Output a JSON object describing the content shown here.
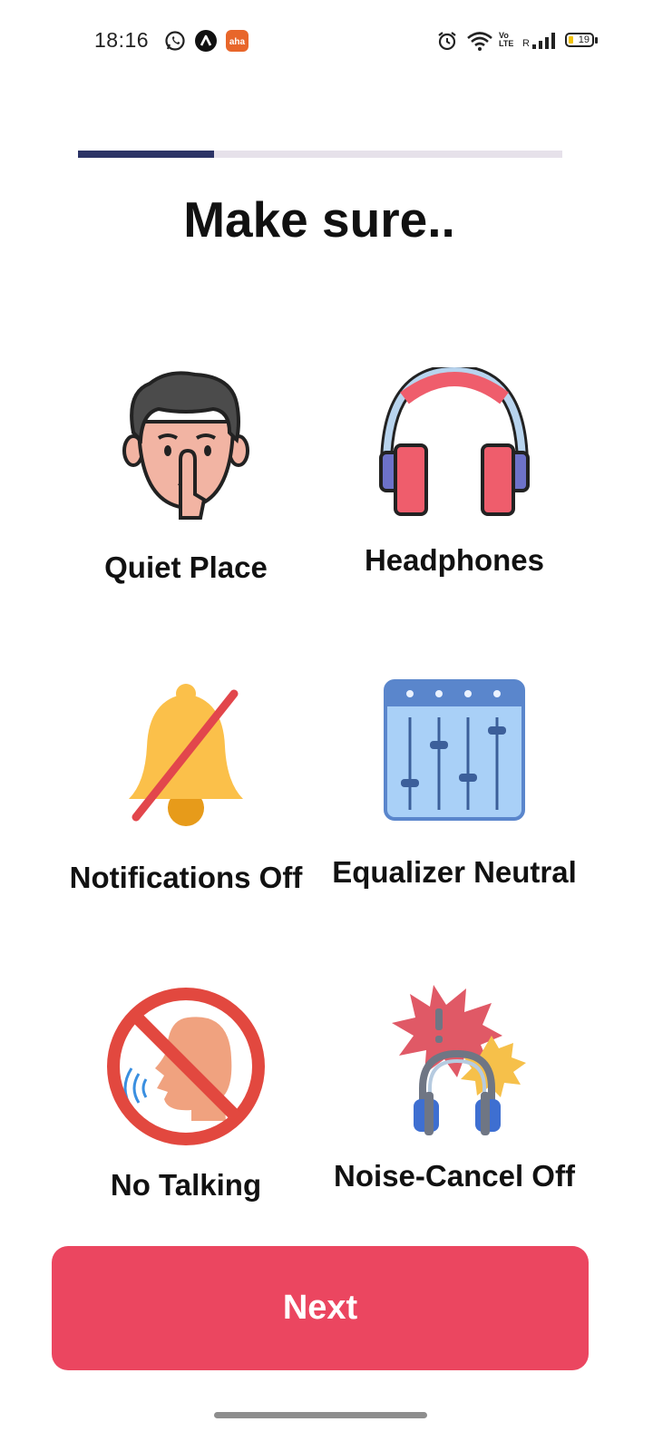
{
  "status_bar": {
    "time": "18:16",
    "battery": "19",
    "network_r": "R",
    "volte": "Vo\nLTE",
    "left_icons": [
      "whatsapp-icon",
      "app-a-icon",
      "aha-icon"
    ],
    "right_icons": [
      "alarm-icon",
      "wifi-icon",
      "volte-icon",
      "signal-icon",
      "battery-icon"
    ],
    "aha_badge": "aha"
  },
  "progress": {
    "value": 0.28,
    "fill_color": "#2b3366",
    "track_color": "#e6e1ea"
  },
  "title": "Make sure..",
  "items": [
    {
      "label": "Quiet Place",
      "icon": "quiet-face-icon"
    },
    {
      "label": "Headphones",
      "icon": "headphones-icon"
    },
    {
      "label": "Notifications Off",
      "icon": "bell-off-icon"
    },
    {
      "label": "Equalizer Neutral",
      "icon": "equalizer-icon"
    },
    {
      "label": "No Talking",
      "icon": "no-talking-icon"
    },
    {
      "label": "Noise-Cancel Off",
      "icon": "noise-cancel-icon"
    }
  ],
  "next_button": {
    "label": "Next",
    "color": "#eb4660"
  }
}
